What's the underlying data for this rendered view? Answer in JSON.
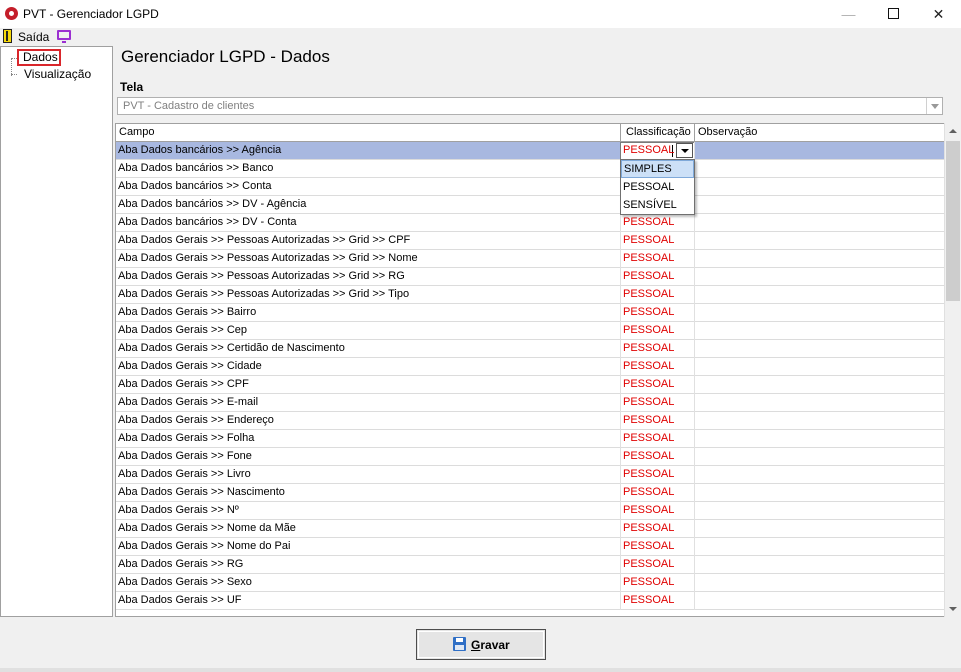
{
  "window": {
    "title": "PVT - Gerenciador LGPD"
  },
  "menu": {
    "exit_label": "Saída"
  },
  "tree": {
    "items": [
      "Dados",
      "Visualização"
    ]
  },
  "main": {
    "heading": "Gerenciador LGPD - Dados",
    "tela_label": "Tela",
    "tela_value": "PVT - Cadastro de clientes"
  },
  "grid": {
    "columns": [
      "Campo",
      "Classificação",
      "Observação"
    ],
    "rows": [
      {
        "campo": "Aba Dados bancários >> Agência",
        "classificacao": "PESSOAL",
        "observacao": ""
      },
      {
        "campo": "Aba Dados bancários >> Banco",
        "classificacao": "",
        "observacao": ""
      },
      {
        "campo": "Aba Dados bancários >> Conta",
        "classificacao": "",
        "observacao": ""
      },
      {
        "campo": "Aba Dados bancários >> DV - Agência",
        "classificacao": "",
        "observacao": ""
      },
      {
        "campo": "Aba Dados bancários >> DV - Conta",
        "classificacao": "PESSOAL",
        "observacao": ""
      },
      {
        "campo": "Aba Dados Gerais >>  Pessoas Autorizadas >> Grid >> CPF",
        "classificacao": "PESSOAL",
        "observacao": ""
      },
      {
        "campo": "Aba Dados Gerais >>  Pessoas Autorizadas >> Grid >> Nome",
        "classificacao": "PESSOAL",
        "observacao": ""
      },
      {
        "campo": "Aba Dados Gerais >>  Pessoas Autorizadas >> Grid >> RG",
        "classificacao": "PESSOAL",
        "observacao": ""
      },
      {
        "campo": "Aba Dados Gerais >>  Pessoas Autorizadas >> Grid >> Tipo",
        "classificacao": "PESSOAL",
        "observacao": ""
      },
      {
        "campo": "Aba Dados Gerais >> Bairro",
        "classificacao": "PESSOAL",
        "observacao": ""
      },
      {
        "campo": "Aba Dados Gerais >> Cep",
        "classificacao": "PESSOAL",
        "observacao": ""
      },
      {
        "campo": "Aba Dados Gerais >> Certidão de Nascimento",
        "classificacao": "PESSOAL",
        "observacao": ""
      },
      {
        "campo": "Aba Dados Gerais >> Cidade",
        "classificacao": "PESSOAL",
        "observacao": ""
      },
      {
        "campo": "Aba Dados Gerais >> CPF",
        "classificacao": "PESSOAL",
        "observacao": ""
      },
      {
        "campo": "Aba Dados Gerais >> E-mail",
        "classificacao": "PESSOAL",
        "observacao": ""
      },
      {
        "campo": "Aba Dados Gerais >> Endereço",
        "classificacao": "PESSOAL",
        "observacao": ""
      },
      {
        "campo": "Aba Dados Gerais >> Folha",
        "classificacao": "PESSOAL",
        "observacao": ""
      },
      {
        "campo": "Aba Dados Gerais >> Fone",
        "classificacao": "PESSOAL",
        "observacao": ""
      },
      {
        "campo": "Aba Dados Gerais >> Livro",
        "classificacao": "PESSOAL",
        "observacao": ""
      },
      {
        "campo": "Aba Dados Gerais >> Nascimento",
        "classificacao": "PESSOAL",
        "observacao": ""
      },
      {
        "campo": "Aba Dados Gerais >> Nº",
        "classificacao": "PESSOAL",
        "observacao": ""
      },
      {
        "campo": "Aba Dados Gerais >> Nome da Mãe",
        "classificacao": "PESSOAL",
        "observacao": ""
      },
      {
        "campo": "Aba Dados Gerais >> Nome do Pai",
        "classificacao": "PESSOAL",
        "observacao": ""
      },
      {
        "campo": "Aba Dados Gerais >> RG",
        "classificacao": "PESSOAL",
        "observacao": ""
      },
      {
        "campo": "Aba Dados Gerais >> Sexo",
        "classificacao": "PESSOAL",
        "observacao": ""
      },
      {
        "campo": "Aba Dados Gerais >> UF",
        "classificacao": "PESSOAL",
        "observacao": ""
      }
    ]
  },
  "dropdown": {
    "options": [
      "SIMPLES",
      "PESSOAL",
      "SENSÍVEL"
    ],
    "highlighted": "SIMPLES"
  },
  "footer": {
    "save_prefix": "",
    "save_accel": "G",
    "save_rest": "ravar"
  },
  "colors": {
    "classification_text": "#e00000",
    "active_row": "#a8b8e0",
    "highlight_box": "#d9262b"
  }
}
